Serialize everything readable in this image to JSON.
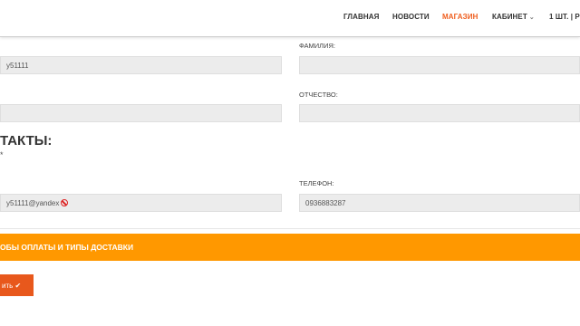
{
  "nav": {
    "items": [
      "ГЛАВНАЯ",
      "НОВОСТИ",
      "МАГАЗИН",
      "КАБИНЕТ"
    ],
    "cart": "1 ШТ. | Р"
  },
  "form": {
    "login_value": "y51111",
    "surname_label": "ФАМИЛИЯ:",
    "surname_value": "",
    "patronymic_label": "ОТЧЕСТВО:",
    "patronymic_value": "",
    "second_left_value": "",
    "contacts_heading": "ТАКТЫ:",
    "contacts_note": "*",
    "email_value": "y51111@yandex",
    "phone_label": "ТЕЛЕФОН:",
    "phone_value": "0936883287"
  },
  "payment_bar": "ОБЫ ОПЛАТЫ И ТИПЫ ДОСТАВКИ",
  "submit_label": "ить ✔",
  "colors": {
    "accent": "#ef5f1f",
    "bar": "#ff9800",
    "button": "#e8581c",
    "field_bg": "#ececec"
  }
}
